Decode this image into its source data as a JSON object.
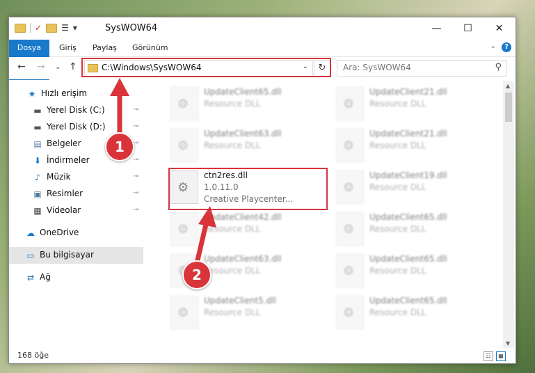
{
  "window": {
    "title": "SysWOW64",
    "minimize": "—",
    "maximize": "☐",
    "close": "✕"
  },
  "quick_access_toolbar": {
    "dropdown": "▾",
    "checkmark": "✓",
    "properties": "☰"
  },
  "ribbon": {
    "tabs": [
      {
        "label": "Dosya"
      },
      {
        "label": "Giriş"
      },
      {
        "label": "Paylaş"
      },
      {
        "label": "Görünüm"
      }
    ],
    "help": "?",
    "collapse": "⌄"
  },
  "navigation": {
    "back": "←",
    "forward": "→",
    "recent": "⌄",
    "up": "↑",
    "address_path": "C:\\Windows\\SysWOW64",
    "address_dropdown": "⌄",
    "refresh": "↻",
    "search_placeholder": "Ara: SysWOW64",
    "search_icon": "⚲"
  },
  "sidebar": {
    "items": [
      {
        "label": "Hızlı erişim",
        "icon": "star-icon",
        "glyph": "★",
        "color": "#1979ca",
        "pinned": false
      },
      {
        "label": "Yerel Disk (C:)",
        "icon": "drive-icon",
        "glyph": "▬",
        "color": "#555555",
        "pinned": true
      },
      {
        "label": "Yerel Disk (D:)",
        "icon": "drive-icon",
        "glyph": "▬",
        "color": "#555555",
        "pinned": true
      },
      {
        "label": "Belgeler",
        "icon": "documents-icon",
        "glyph": "▤",
        "color": "#5a7fa8",
        "pinned": true
      },
      {
        "label": "İndirmeler",
        "icon": "download-icon",
        "glyph": "⬇",
        "color": "#1979ca",
        "pinned": true
      },
      {
        "label": "Müzik",
        "icon": "music-icon",
        "glyph": "♪",
        "color": "#1979ca",
        "pinned": true
      },
      {
        "label": "Resimler",
        "icon": "pictures-icon",
        "glyph": "▣",
        "color": "#4f7a9e",
        "pinned": true
      },
      {
        "label": "Videolar",
        "icon": "video-icon",
        "glyph": "▦",
        "color": "#444444",
        "pinned": true
      },
      {
        "label": "OneDrive",
        "icon": "cloud-icon",
        "glyph": "☁",
        "color": "#1979ca",
        "pinned": false
      },
      {
        "label": "Bu bilgisayar",
        "icon": "computer-icon",
        "glyph": "▭",
        "color": "#2a7ab8",
        "pinned": false
      },
      {
        "label": "Ağ",
        "icon": "network-icon",
        "glyph": "⇄",
        "color": "#2a7ab8",
        "pinned": false
      }
    ],
    "pin_glyph": "📌"
  },
  "files": {
    "gear_glyph": "⚙",
    "left_column": [
      {
        "name": "UpdateClient65.dll",
        "desc": "Resource DLL"
      },
      {
        "name": "UpdateClient63.dll",
        "desc": "Resource DLL"
      },
      {
        "name": "UpdateClient42.dll",
        "desc": "Resource DLL"
      },
      {
        "name": "UpdateClient63.dll",
        "desc": "Resource DLL"
      },
      {
        "name": "UpdateClient5.dll",
        "desc": "Resource DLL"
      }
    ],
    "right_column": [
      {
        "name": "UpdateClient21.dll",
        "desc": "Resource DLL"
      },
      {
        "name": "UpdateClient21.dll",
        "desc": "Resource DLL"
      },
      {
        "name": "UpdateClient19.dll",
        "desc": "Resource DLL"
      },
      {
        "name": "UpdateClient65.dll",
        "desc": "Resource DLL"
      },
      {
        "name": "UpdateClient65.dll",
        "desc": "Resource DLL"
      },
      {
        "name": "UpdateClient65.dll",
        "desc": "Resource DLL"
      }
    ],
    "highlighted": {
      "name": "ctn2res.dll",
      "version": "1.0.11.0",
      "company": "Creative Playcenter..."
    }
  },
  "annotations": {
    "step1": "1",
    "step2": "2",
    "highlight_color": "#d9343a"
  },
  "status": {
    "item_count": "168 öğe",
    "details_view": "☷",
    "icons_view": "▦"
  }
}
